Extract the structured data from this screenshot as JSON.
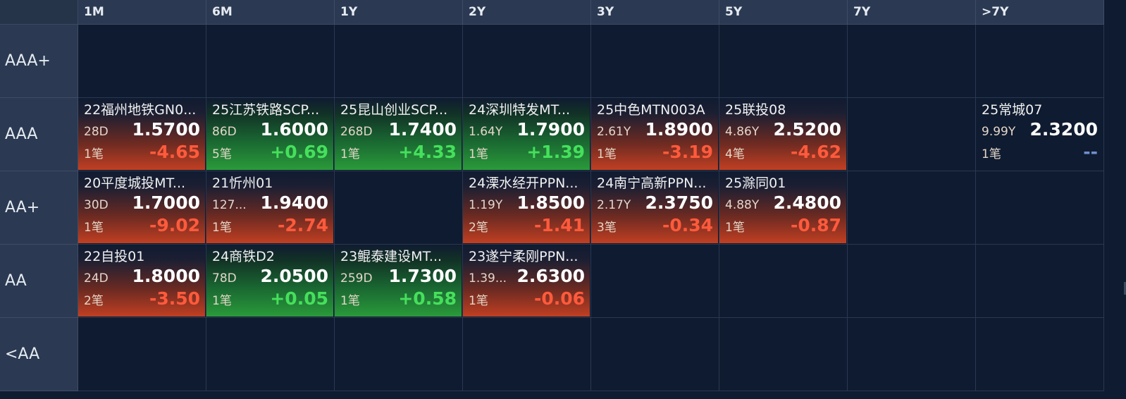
{
  "columns": [
    "1M",
    "6M",
    "1Y",
    "2Y",
    "3Y",
    "5Y",
    "7Y",
    ">7Y"
  ],
  "rows": [
    "AAA+",
    "AAA",
    "AA+",
    "AA",
    "<AA"
  ],
  "cells": [
    {
      "row": 1,
      "col": 0,
      "name": "22福州地铁GN0...",
      "term": "28D",
      "yield": "1.5700",
      "count": "1笔",
      "change": "-4.65",
      "trend": "neg"
    },
    {
      "row": 1,
      "col": 1,
      "name": "25江苏铁路SCP...",
      "term": "86D",
      "yield": "1.6000",
      "count": "5笔",
      "change": "+0.69",
      "trend": "pos"
    },
    {
      "row": 1,
      "col": 2,
      "name": "25昆山创业SCP...",
      "term": "268D",
      "yield": "1.7400",
      "count": "1笔",
      "change": "+4.33",
      "trend": "pos"
    },
    {
      "row": 1,
      "col": 3,
      "name": "24深圳特发MT...",
      "term": "1.64Y",
      "yield": "1.7900",
      "count": "1笔",
      "change": "+1.39",
      "trend": "pos"
    },
    {
      "row": 1,
      "col": 4,
      "name": "25中色MTN003A",
      "term": "2.61Y",
      "yield": "1.8900",
      "count": "1笔",
      "change": "-3.19",
      "trend": "neg"
    },
    {
      "row": 1,
      "col": 5,
      "name": "25联投08",
      "term": "4.86Y",
      "yield": "2.5200",
      "count": "4笔",
      "change": "-4.62",
      "trend": "neg"
    },
    {
      "row": 1,
      "col": 7,
      "name": "25常城07",
      "term": "9.99Y",
      "yield": "2.3200",
      "count": "1笔",
      "change": "--",
      "trend": "flat"
    },
    {
      "row": 2,
      "col": 0,
      "name": "20平度城投MT...",
      "term": "30D",
      "yield": "1.7000",
      "count": "1笔",
      "change": "-9.02",
      "trend": "neg"
    },
    {
      "row": 2,
      "col": 1,
      "name": "21忻州01",
      "term": "127...",
      "yield": "1.9400",
      "count": "1笔",
      "change": "-2.74",
      "trend": "neg"
    },
    {
      "row": 2,
      "col": 3,
      "name": "24溧水经开PPN...",
      "term": "1.19Y",
      "yield": "1.8500",
      "count": "2笔",
      "change": "-1.41",
      "trend": "neg"
    },
    {
      "row": 2,
      "col": 4,
      "name": "24南宁高新PPN...",
      "term": "2.17Y",
      "yield": "2.3750",
      "count": "3笔",
      "change": "-0.34",
      "trend": "neg"
    },
    {
      "row": 2,
      "col": 5,
      "name": "25滁同01",
      "term": "4.88Y",
      "yield": "2.4800",
      "count": "1笔",
      "change": "-0.87",
      "trend": "neg"
    },
    {
      "row": 3,
      "col": 0,
      "name": "22自投01",
      "term": "24D",
      "yield": "1.8000",
      "count": "2笔",
      "change": "-3.50",
      "trend": "neg"
    },
    {
      "row": 3,
      "col": 1,
      "name": "24商铁D2",
      "term": "78D",
      "yield": "2.0500",
      "count": "1笔",
      "change": "+0.05",
      "trend": "pos"
    },
    {
      "row": 3,
      "col": 2,
      "name": "23鲲泰建设MT...",
      "term": "259D",
      "yield": "1.7300",
      "count": "1笔",
      "change": "+0.58",
      "trend": "pos"
    },
    {
      "row": 3,
      "col": 3,
      "name": "23遂宁柔刚PPN...",
      "term": "1.39...",
      "yield": "2.6300",
      "count": "1笔",
      "change": "-0.06",
      "trend": "neg"
    }
  ]
}
